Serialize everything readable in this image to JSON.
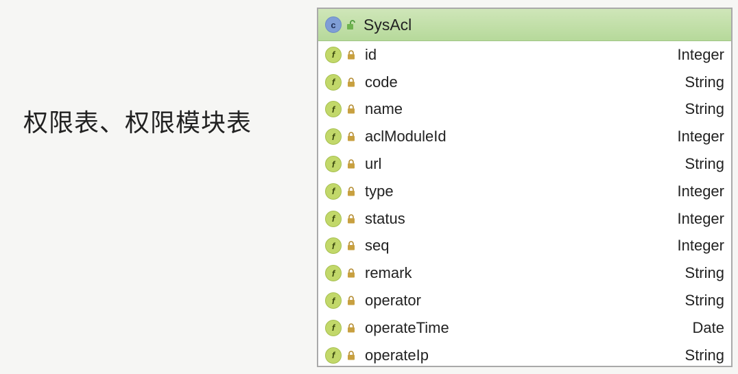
{
  "caption": "权限表、权限模块表",
  "class_box": {
    "type_badge": "c",
    "name": "SysAcl",
    "field_badge": "f",
    "fields": [
      {
        "name": "id",
        "type": "Integer"
      },
      {
        "name": "code",
        "type": "String"
      },
      {
        "name": "name",
        "type": "String"
      },
      {
        "name": "aclModuleId",
        "type": "Integer"
      },
      {
        "name": "url",
        "type": "String"
      },
      {
        "name": "type",
        "type": "Integer"
      },
      {
        "name": "status",
        "type": "Integer"
      },
      {
        "name": "seq",
        "type": "Integer"
      },
      {
        "name": "remark",
        "type": "String"
      },
      {
        "name": "operator",
        "type": "String"
      },
      {
        "name": "operateTime",
        "type": "Date"
      },
      {
        "name": "operateIp",
        "type": "String"
      }
    ]
  },
  "colors": {
    "header_green": "#b6d99a",
    "class_badge_blue": "#7f9ed6",
    "field_badge_green": "#c2d86a",
    "lock_gold": "#c8a040"
  },
  "icons": {
    "class_badge": "class-icon",
    "public_visibility": "unlocked-icon",
    "field_badge": "field-icon",
    "private_visibility": "lock-icon"
  }
}
